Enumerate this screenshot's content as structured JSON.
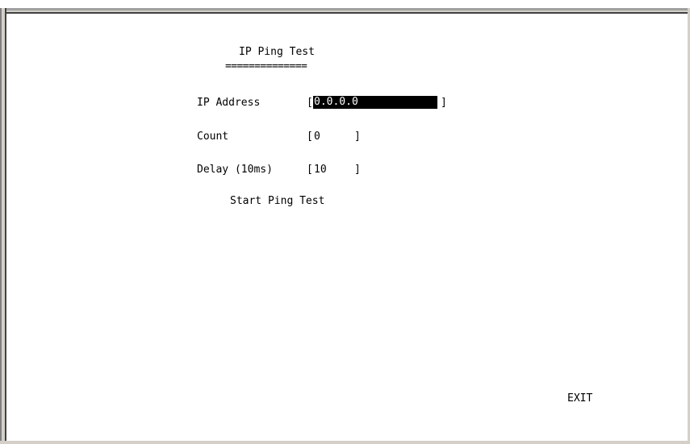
{
  "screen": {
    "title": "IP Ping Test",
    "title_underline": "==============",
    "fields": {
      "ip_address": {
        "label": "IP Address",
        "open_bracket": "[",
        "value": "0.0.0.0",
        "close_bracket": "]"
      },
      "count": {
        "label": "Count",
        "open_bracket": "[",
        "value": "0",
        "close_bracket": "]"
      },
      "delay": {
        "label": "Delay (10ms)",
        "open_bracket": "[",
        "value": "10",
        "close_bracket": "]"
      }
    },
    "start_action": "Start Ping Test",
    "exit_action": "EXIT"
  },
  "colors": {
    "background": "#ffffff",
    "text": "#000000",
    "selected_field_bg": "#000000",
    "selected_field_text": "#ffffff",
    "frame": "#d4d0c8"
  }
}
